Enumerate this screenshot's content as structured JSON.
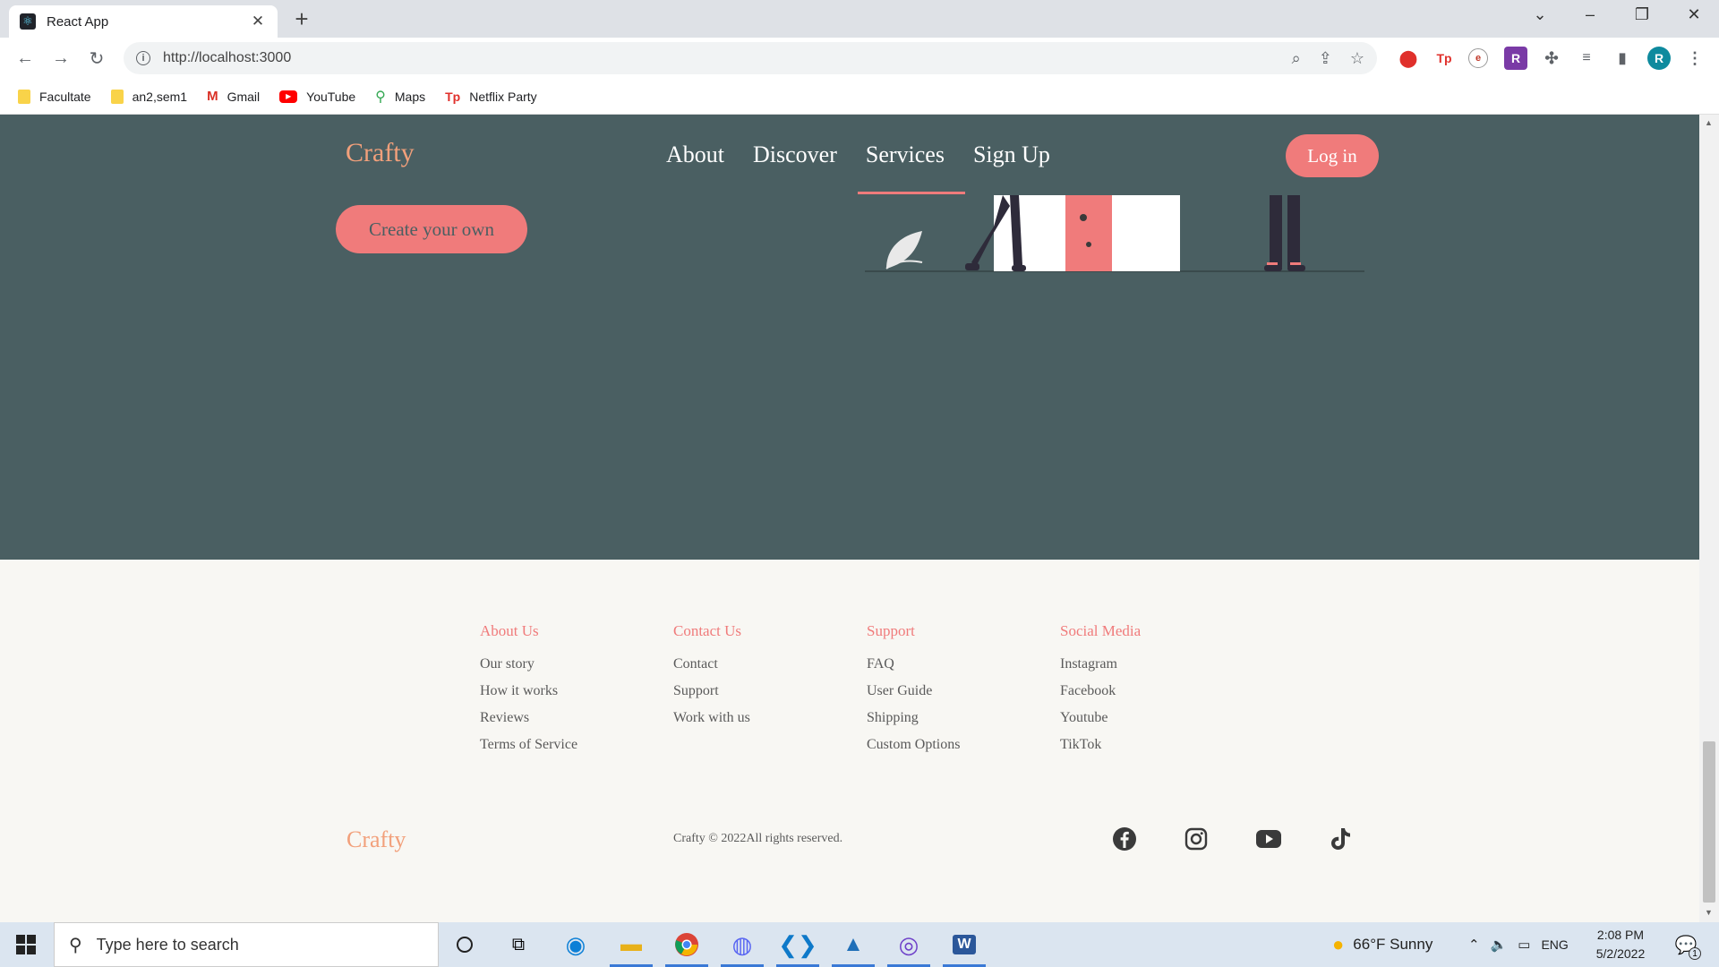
{
  "browser": {
    "tab_title": "React App",
    "url": "http://localhost:3000",
    "bookmarks": [
      "Facultate",
      "an2,sem1",
      "Gmail",
      "YouTube",
      "Maps",
      "Netflix Party"
    ],
    "profile_initial": "R"
  },
  "site": {
    "brand": "Crafty",
    "nav": [
      "About",
      "Discover",
      "Services",
      "Sign Up"
    ],
    "active_nav": "Services",
    "login_label": "Log in",
    "create_label": "Create your own",
    "colors": {
      "hero_bg": "#4a5f62",
      "accent": "#f07b7b",
      "brand": "#f2a07b",
      "footer_bg": "#f8f7f3"
    }
  },
  "footer": {
    "columns": [
      {
        "heading": "About Us",
        "links": [
          "Our story",
          "How it works",
          "Reviews",
          "Terms of Service"
        ]
      },
      {
        "heading": "Contact Us",
        "links": [
          "Contact",
          "Support",
          "Work with us"
        ]
      },
      {
        "heading": "Support",
        "links": [
          "FAQ",
          "User Guide",
          "Shipping",
          "Custom Options"
        ]
      },
      {
        "heading": "Social Media",
        "links": [
          "Instagram",
          "Facebook",
          "Youtube",
          "TikTok"
        ]
      }
    ],
    "brand": "Crafty",
    "copyright": "Crafty © 2022All rights reserved.",
    "social_icons": [
      "facebook-icon",
      "instagram-icon",
      "youtube-icon",
      "tiktok-icon"
    ]
  },
  "taskbar": {
    "search_placeholder": "Type here to search",
    "weather": "66°F  Sunny",
    "language": "ENG",
    "time": "2:08 PM",
    "date": "5/2/2022",
    "notification_count": "1"
  }
}
